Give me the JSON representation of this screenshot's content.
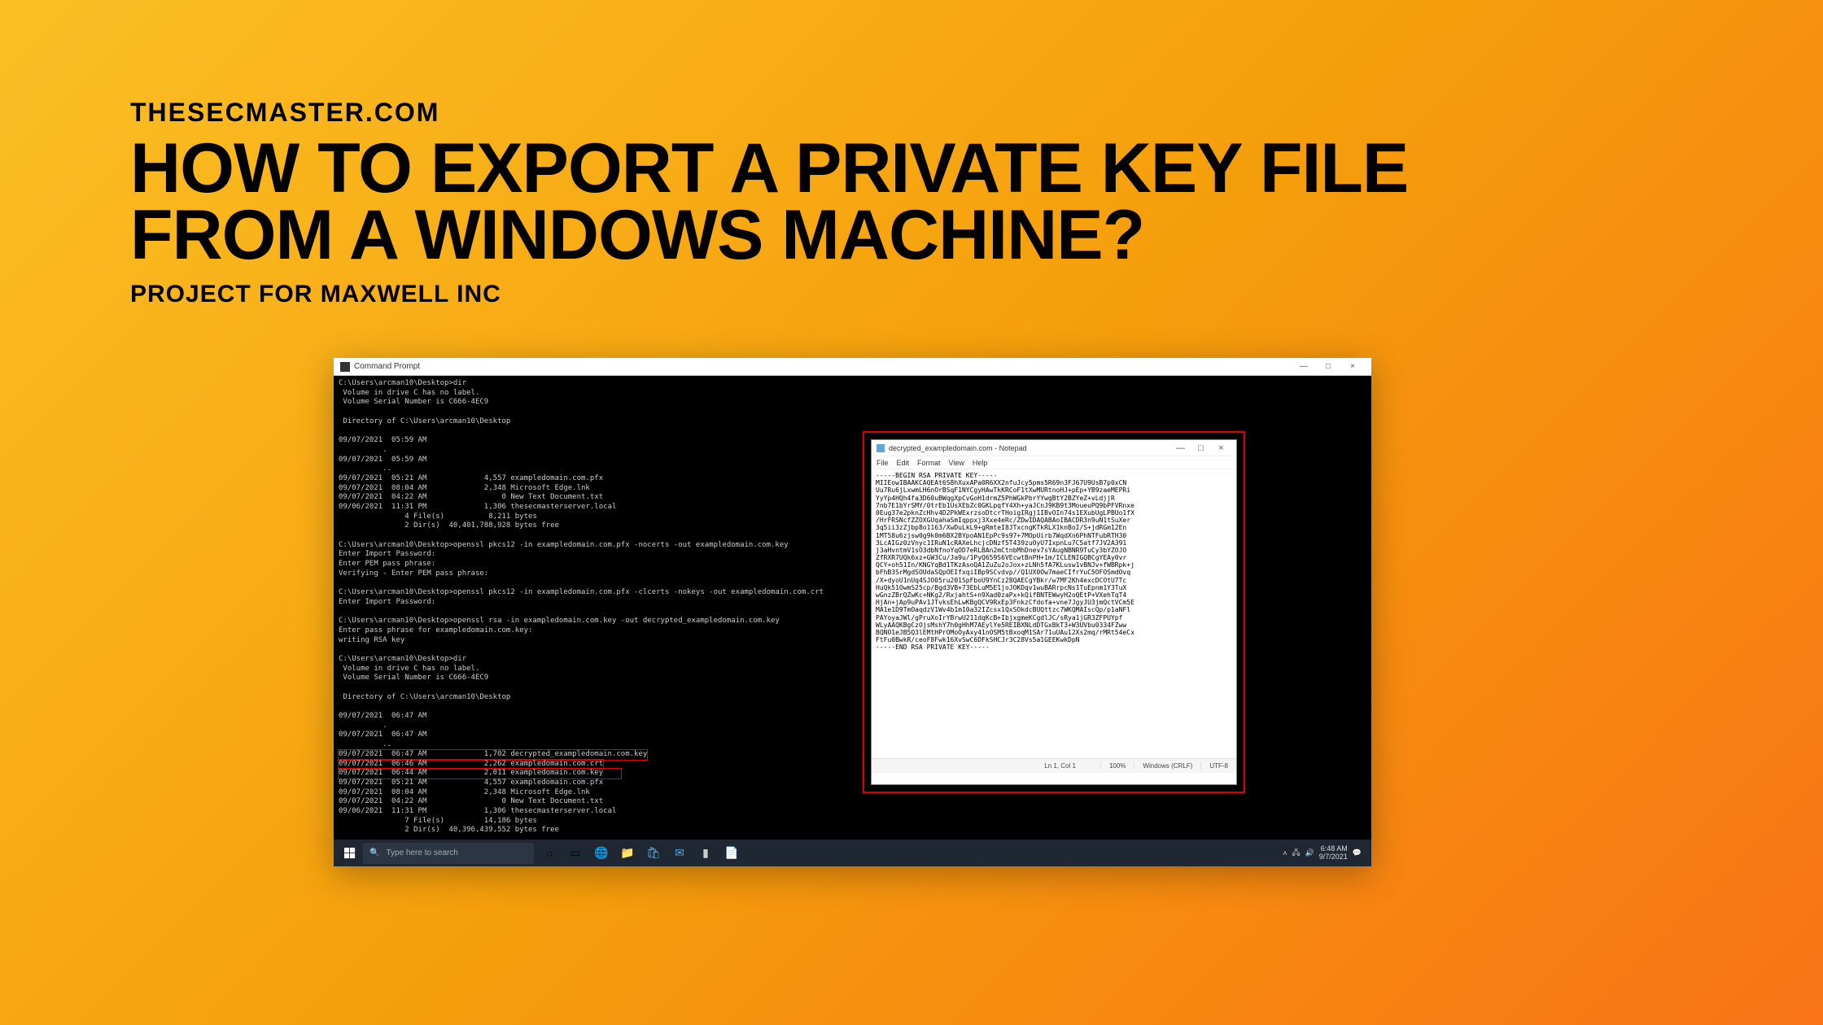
{
  "header": {
    "site": "THESECMASTER.COM",
    "title_line1": "HOW TO EXPORT A PRIVATE KEY FILE",
    "title_line2": "FROM A WINDOWS MACHINE?",
    "subtitle": "PROJECT FOR MAXWELL INC"
  },
  "cmd": {
    "title": "Command Prompt",
    "minimize": "—",
    "maximize": "□",
    "close": "×",
    "lines_pre": [
      "C:\\Users\\arcman10\\Desktop>dir",
      " Volume in drive C has no label.",
      " Volume Serial Number is C666-4EC9",
      "",
      " Directory of C:\\Users\\arcman10\\Desktop",
      "",
      "09/07/2021  05:59 AM    <DIR>          .",
      "09/07/2021  05:59 AM    <DIR>          ..",
      "09/07/2021  05:21 AM             4,557 exampledomain.com.pfx",
      "09/07/2021  08:04 AM             2,348 Microsoft Edge.lnk",
      "09/07/2021  04:22 AM                 0 New Text Document.txt",
      "09/06/2021  11:31 PM             1,306 thesecmasterserver.local",
      "               4 File(s)          8,211 bytes",
      "               2 Dir(s)  40,401,788,928 bytes free",
      "",
      "C:\\Users\\arcman10\\Desktop>openssl pkcs12 -in exampledomain.com.pfx -nocerts -out exampledomain.com.key",
      "Enter Import Password:",
      "Enter PEM pass phrase:",
      "Verifying - Enter PEM pass phrase:",
      "",
      "C:\\Users\\arcman10\\Desktop>openssl pkcs12 -in exampledomain.com.pfx -clcerts -nokeys -out exampledomain.com.crt",
      "Enter Import Password:",
      "",
      "C:\\Users\\arcman10\\Desktop>openssl rsa -in exampledomain.com.key -out decrypted_exampledomain.com.key",
      "Enter pass phrase for exampledomain.com.key:",
      "writing RSA key",
      "",
      "C:\\Users\\arcman10\\Desktop>dir",
      " Volume in drive C has no label.",
      " Volume Serial Number is C666-4EC9",
      "",
      " Directory of C:\\Users\\arcman10\\Desktop",
      "",
      "09/07/2021  06:47 AM    <DIR>          .",
      "09/07/2021  06:47 AM    <DIR>          .."
    ],
    "lines_highlight": [
      "09/07/2021  06:47 AM             1,702 decrypted_exampledomain.com.key",
      "09/07/2021  06:46 AM             2,262 exampledomain.com.crt",
      "09/07/2021  06:44 AM             2,011 exampledomain.com.key    "
    ],
    "lines_post": [
      "09/07/2021  05:21 AM             4,557 exampledomain.com.pfx",
      "09/07/2021  08:04 AM             2,348 Microsoft Edge.lnk",
      "09/07/2021  04:22 AM                 0 New Text Document.txt",
      "09/06/2021  11:31 PM             1,306 thesecmasterserver.local",
      "               7 File(s)         14,186 bytes",
      "               2 Dir(s)  40,396,439,552 bytes free",
      "",
      "C:\\Users\\arcman10\\Desktop>"
    ]
  },
  "notepad": {
    "title": "decrypted_exampledomain.com - Notepad",
    "menus": [
      "File",
      "Edit",
      "Format",
      "View",
      "Help"
    ],
    "minimize": "—",
    "maximize": "□",
    "close": "×",
    "content": "-----BEGIN RSA PRIVATE KEY-----\nMIIEowIBAAKCAQEAt6S8hXuxAPa0R6XX2nfuJcy5pms5R69n3FJ67U9UsB7p0xCN\nUu7Ru6jLxwmLH6nOrBSqF1NYCgyHAwTkKRCoF1tXwMURtnoHJ+pEp+YB9zaeMEPRi\nYyYp4HQh4fa3D60uBWqgXpCvGoH1drmZ5PhWGkPbrYYwgBtY2BZYeZ+vLdjjR\n7nb7E1bYrSMY/0trEb1UsXEbZc0GKLpqfY4Xh+yaJCnJ9KB9t3MoueuPQ9bPFVRnxe\n0Eug37e2pknZcHhv4D2PkWExrzsoDtcrTHoigIRgj1IBvOIn74s1EXubUgLPBUo1fX\n/HrFRSNcfZZOXGUqahaSmIqppxj3Xxe4eRc/ZDwIDAQABAoIBACDR3n9uN1tSuXer\n3q5ii3zZjbp8o1163/XwDuLkL9+gRmteI8JTxcngKTkRLX1knBoI/S+jdRGm12En\n1MT58u6zjsw0g9k0m6BX2BYpoAN1EpPc9s97+7MOpUirb7WqdXn6PhNTFubRTH30\n3LcAIGz0zVnyc1IRuN1cRAXeLhcjcDNzf5T439zuOyU7IxpnLu7C5atf7JV2A391\nj3aHvntmV1sO3dbNfnoYqOD7eRLBAn2mCtnbMhDnev7sYAugNBNR9TuCy3bYZOJO\nZfRXR7UQk6xz+GW3Cu/Ja9u/1PyQ659S6VEcwtBnPH+1m/ICLENIGQBCgYEAy0vr\nQCY+oh51In/KNGYqBd1TKzAsoQA1ZuZu2oJox+zLNh5fA7KLusw1vBNJv+fWBRpk+j\nbFhB3SrMgdSOUdaSQpOEIfxqiIBp9SCvdvp//Q1UX0Ow7maeCIfrYuC5OFOSmdOvq\n/X+dyoU1nUq4SJO05ru201SpFboU9YnCz28QAECgYBkr/w7MF2Kh4excDCOtU7Tc\nHuQk51OwmS25cp/Bgd3VB+73EbLuM5E1joJOKDqv1wuBARrpcNs1TuEpnm1Y3TuX\nwGnzZBrQZwKc+NKg2/RxjahtS+n9Xad0zaPx+kQifBNTEWwyH2oQEtP+VXehTqT4\nHjAn+jAp9uPAv1JTvksEhLwKBgQCV9RxEp3FnkzCfdofa+vne7JgyJU3jmQctVCm5E\nMA1e1D9TmOaqdzV1Wv4b1m10a32IZcsx1QxSOkdcBUQttzc7WKQMAIscQp/p1aNFl\nPAYoyaJWl/gPruXoIrYBrwU211dqKcB+IbjxgmeKCgdlJC/sRya1jGR3ZFPUYpf\nWLyAAQKBgCzOjsMshY7h0gHhM7AEylYe5REIBXNLdDTGxBkT3+W3UVbu0334FZww\nBQNO1eJB5Q3lEMtHPrOMoOyAxy41nOSM5tBxoqM1SAr71uUAu12Xs2mq/rMRt54eCx\nFtFu0BwkR/ceoF8Fwk16XvSwC6DFkSHCJr3C28Vs5a1GEEKwkDpN\n-----END RSA PRIVATE KEY-----",
    "status": {
      "pos": "Ln 1, Col 1",
      "zoom": "100%",
      "eol": "Windows (CRLF)",
      "enc": "UTF-8"
    }
  },
  "taskbar": {
    "search_placeholder": "Type here to search",
    "clock_time": "6:48 AM",
    "clock_date": "9/7/2021"
  }
}
